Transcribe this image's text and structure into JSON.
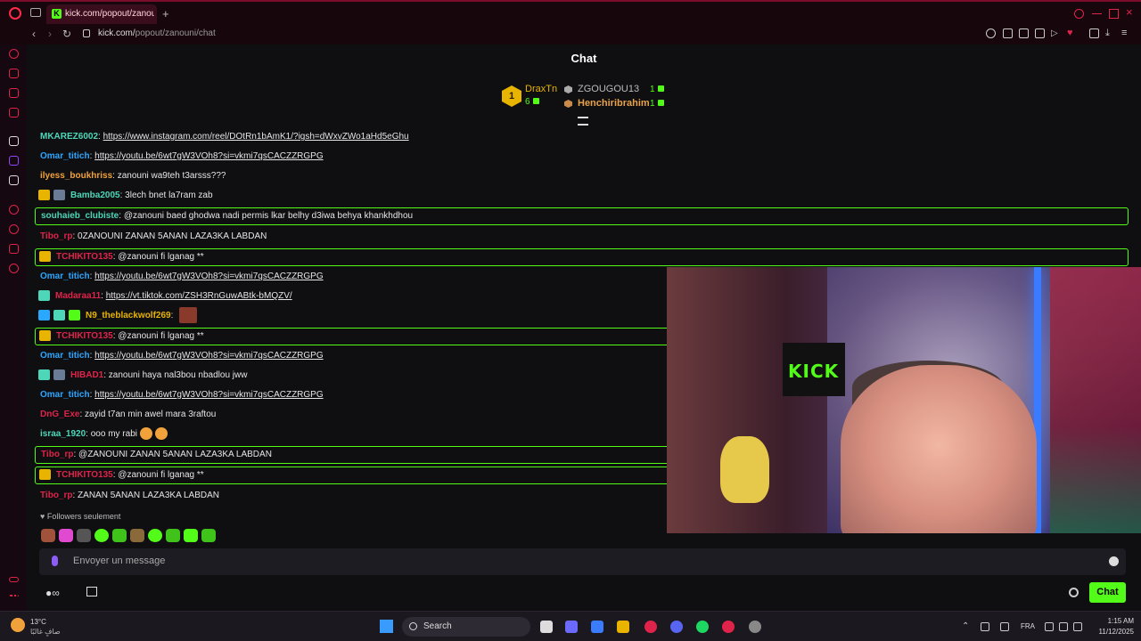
{
  "browser": {
    "tab_title": "kick.com/popout/zanoun",
    "url_host": "kick.com/",
    "url_path": "popout/zanouni/chat"
  },
  "chat": {
    "title": "Chat",
    "leaderboard": {
      "first": {
        "rank": "1",
        "name": "DraxTn",
        "count": "6"
      },
      "second": {
        "name": "ZGOUGOU13",
        "count": "1"
      },
      "third": {
        "name": "Henchiribrahim",
        "count": "1"
      }
    },
    "messages": [
      {
        "user": "MKAREZ6002",
        "color": "#4dd6b8",
        "text": "https://www.instagram.com/reel/DOtRn1bAmK1/?igsh=dWxvZWo1aHd5eGhu",
        "link": true,
        "badges": [],
        "highlight": false
      },
      {
        "user": "Omar_titich",
        "color": "#2aa7ff",
        "text": "https://youtu.be/6wt7gW3VOh8?si=vkmi7qsCACZZRGPG",
        "link": true,
        "badges": [],
        "highlight": false
      },
      {
        "user": "ilyess_boukhriss",
        "color": "#f2a23a",
        "text": "zanouni wa9teh t3arsss???",
        "link": false,
        "badges": [],
        "highlight": false
      },
      {
        "user": "Bamba2005",
        "color": "#4dd6b8",
        "text": "3lech bnet la7ram zab",
        "link": false,
        "badges": [
          "crown",
          "grey"
        ],
        "highlight": false
      },
      {
        "user": "souhaieb_clubiste",
        "color": "#4dd6b8",
        "text": "@zanouni baed ghodwa nadi permis lkar belhy d3iwa behya khankhdhou",
        "link": false,
        "badges": [],
        "highlight": true
      },
      {
        "user": "Tibo_rp",
        "color": "#e0234a",
        "text": "0ZANOUNI ZANAN 5ANAN LAZA3KA LABDAN",
        "link": false,
        "badges": [],
        "highlight": false
      },
      {
        "user": "TCHIKITO135",
        "color": "#e0234a",
        "text": "@zanouni fi lganag **",
        "link": false,
        "badges": [
          "crown"
        ],
        "highlight": true
      },
      {
        "user": "Omar_titich",
        "color": "#2aa7ff",
        "text": "https://youtu.be/6wt7gW3VOh8?si=vkmi7qsCACZZRGPG",
        "link": true,
        "badges": [],
        "highlight": false
      },
      {
        "user": "Madaraa11",
        "color": "#e0234a",
        "text": "https://vt.tiktok.com/ZSH3RnGuwABtk-bMQZV/",
        "link": true,
        "badges": [
          "gem"
        ],
        "highlight": false
      },
      {
        "user": "N9_theblackwolf269",
        "color": "#e8b400",
        "text": "",
        "link": false,
        "badges": [
          "blue",
          "gem",
          "green"
        ],
        "highlight": false,
        "image_emote": true
      },
      {
        "user": "TCHIKITO135",
        "color": "#e0234a",
        "text": "@zanouni fi lganag **",
        "link": false,
        "badges": [
          "crown"
        ],
        "highlight": true
      },
      {
        "user": "Omar_titich",
        "color": "#2aa7ff",
        "text": "https://youtu.be/6wt7gW3VOh8?si=vkmi7qsCACZZRGPG",
        "link": true,
        "badges": [],
        "highlight": false
      },
      {
        "user": "HIBAD1",
        "color": "#e0234a",
        "text": "zanouni haya nal3bou nbadlou jww",
        "link": false,
        "badges": [
          "gem",
          "grey"
        ],
        "highlight": false
      },
      {
        "user": "Omar_titich",
        "color": "#2aa7ff",
        "text": "https://youtu.be/6wt7gW3VOh8?si=vkmi7qsCACZZRGPG",
        "link": true,
        "badges": [],
        "highlight": false
      },
      {
        "user": "DnG_Exe",
        "color": "#e0234a",
        "text": "zayid t7an min awel mara 3raftou",
        "link": false,
        "badges": [],
        "highlight": false
      },
      {
        "user": "israa_1920",
        "color": "#4dd6b8",
        "text": "ooo my rabi",
        "link": false,
        "badges": [],
        "highlight": false,
        "emotes": 2
      },
      {
        "user": "Tibo_rp",
        "color": "#e0234a",
        "text": "@ZANOUNI ZANAN 5ANAN LAZA3KA LABDAN",
        "link": false,
        "badges": [],
        "highlight": true
      },
      {
        "user": "TCHIKITO135",
        "color": "#e0234a",
        "text": "@zanouni fi lganag **",
        "link": false,
        "badges": [
          "crown"
        ],
        "highlight": true
      },
      {
        "user": "Tibo_rp",
        "color": "#e0234a",
        "text": "ZANAN 5ANAN LAZA3KA LABDAN",
        "link": false,
        "badges": [],
        "highlight": false
      }
    ],
    "webcam_overlay_text": "KICK",
    "followers_only": "Followers seulement",
    "input_placeholder": "Envoyer un message",
    "send_button": "Chat"
  },
  "taskbar": {
    "weather_temp": "13°C",
    "weather_desc": "صافٍ غالبًا",
    "search_label": "Search",
    "language": "FRA",
    "time": "1:15 AM",
    "date": "11/12/2025"
  },
  "colors": {
    "accent": "#53fc18",
    "opera_red": "#e0234a"
  }
}
